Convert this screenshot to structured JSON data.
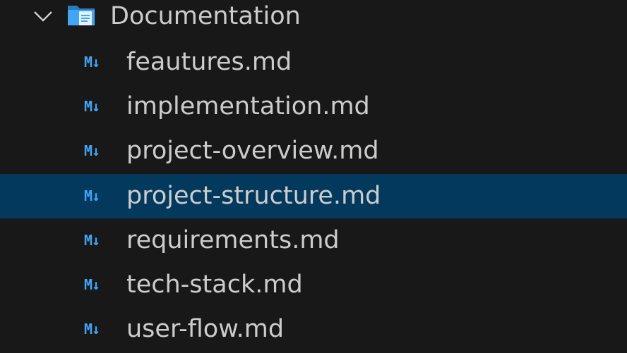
{
  "explorer": {
    "folder": {
      "name": "Documentation",
      "icon": "folder-docs-icon",
      "expanded": true,
      "icon_color": "#42a5f5"
    },
    "file_icon": {
      "name": "markdown-icon",
      "glyph": "M↓",
      "color": "#42a5f5"
    },
    "files": [
      {
        "name": "feautures.md",
        "selected": false
      },
      {
        "name": "implementation.md",
        "selected": false
      },
      {
        "name": "project-overview.md",
        "selected": false
      },
      {
        "name": "project-structure.md",
        "selected": true
      },
      {
        "name": "requirements.md",
        "selected": false
      },
      {
        "name": "tech-stack.md",
        "selected": false
      },
      {
        "name": "user-flow.md",
        "selected": false
      }
    ],
    "colors": {
      "background": "#181818",
      "selected_row": "#04395e",
      "text": "#cccccc"
    }
  }
}
